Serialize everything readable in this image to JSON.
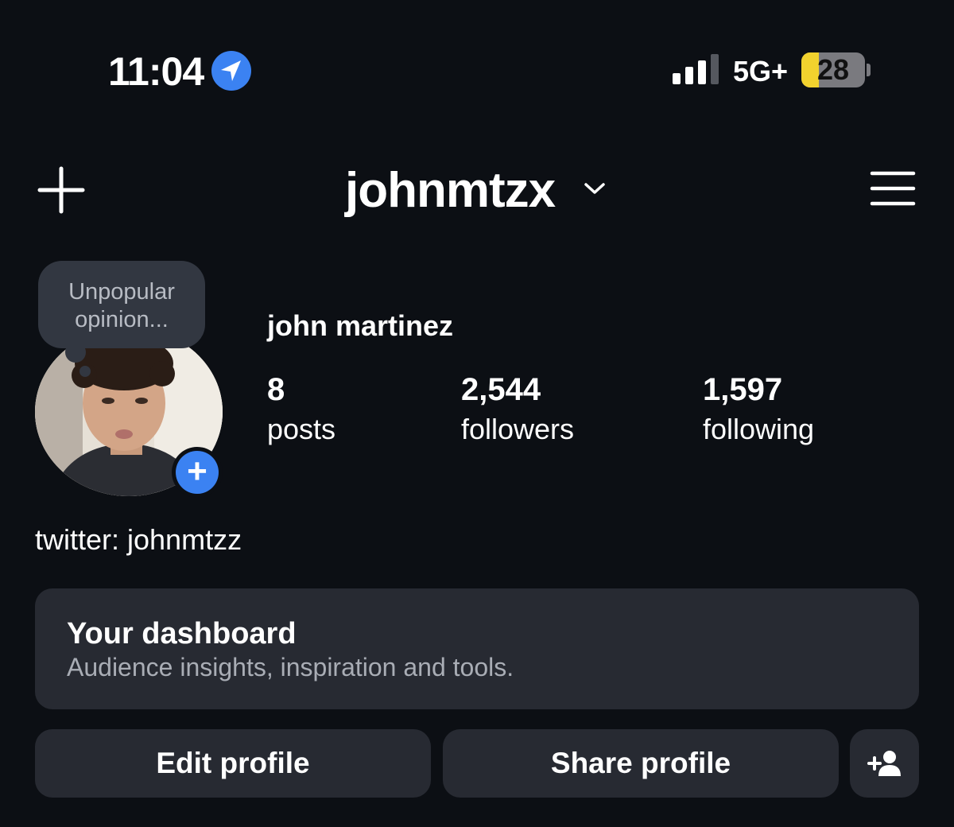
{
  "status_bar": {
    "time": "11:04",
    "network": "5G+",
    "battery": "28",
    "battery_fraction": 0.28,
    "icons": [
      "location-arrow-icon",
      "signal-bars-icon",
      "battery-icon"
    ]
  },
  "header": {
    "username": "johnmtzx",
    "icons": [
      "plus-icon",
      "chevron-down-icon",
      "hamburger-menu-icon"
    ]
  },
  "note": {
    "line1": "Unpopular",
    "line2": "opinion..."
  },
  "profile": {
    "full_name": "john martinez",
    "bio": "twitter: johnmtzz",
    "stats": {
      "posts": {
        "value": "8",
        "label": "posts"
      },
      "followers": {
        "value": "2,544",
        "label": "followers"
      },
      "following": {
        "value": "1,597",
        "label": "following"
      }
    }
  },
  "dashboard": {
    "title": "Your dashboard",
    "subtitle": "Audience insights, inspiration and tools."
  },
  "actions": {
    "edit_profile": "Edit profile",
    "share_profile": "Share profile",
    "add_user_icon": "person-add-icon"
  },
  "colors": {
    "background": "#0c0f14",
    "card": "#272a32",
    "accent_blue": "#3b82f2",
    "battery_yellow": "#f2d22e"
  }
}
